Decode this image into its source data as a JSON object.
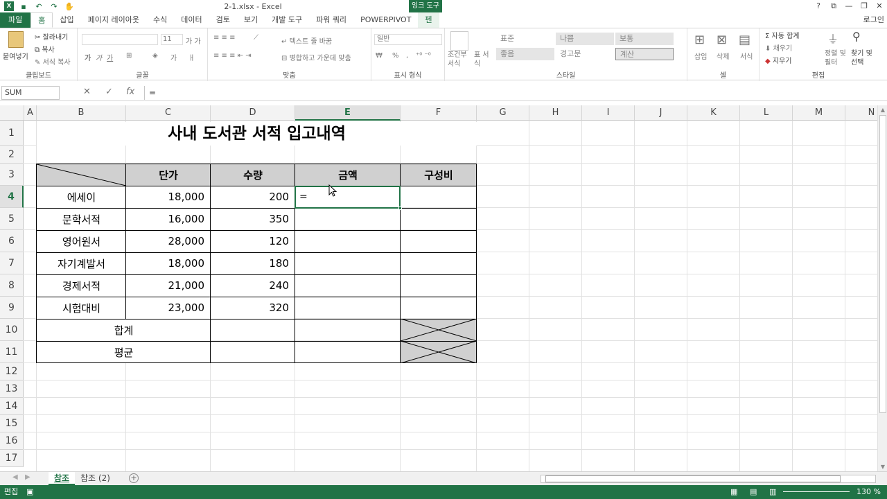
{
  "window": {
    "title": "2-1.xlsx - Excel",
    "context_tab_group": "잉크 도구",
    "controls": [
      "?",
      "⧉",
      "—",
      "❐",
      "✕"
    ],
    "login": "로그인"
  },
  "ribbon_tabs": [
    "파일",
    "홈",
    "삽입",
    "페이지 레이아웃",
    "수식",
    "데이터",
    "검토",
    "보기",
    "개발 도구",
    "파워 쿼리",
    "POWERPIVOT",
    "펜"
  ],
  "active_tab": "홈",
  "ribbon": {
    "clipboard": {
      "label": "클립보드",
      "paste": "붙여넣기",
      "cut": "잘라내기",
      "copy": "복사",
      "format_painter": "서식 복사"
    },
    "font": {
      "label": "글꼴",
      "size": "11",
      "bold": "가",
      "italic": "가",
      "underline": "가"
    },
    "alignment": {
      "label": "맞춤",
      "wrap": "텍스트 줄 바꿈",
      "merge": "병합하고 가운데 맞춤"
    },
    "number": {
      "label": "표시 형식",
      "format": "일반",
      "percent": "%",
      "comma": ","
    },
    "styles": {
      "label": "스타일",
      "conditional": "조건부 서식",
      "table": "표 서식",
      "cells": [
        "표준",
        "나쁨",
        "보통",
        "좋음",
        "경고문",
        "계산"
      ]
    },
    "cells": {
      "label": "셀",
      "insert": "삽입",
      "delete": "삭제",
      "format": "서식"
    },
    "editing": {
      "label": "편집",
      "autosum": "자동 합계",
      "fill": "채우기",
      "clear": "지우기",
      "sort_filter": "정렬 및 필터",
      "find_select": "찾기 및 선택"
    }
  },
  "formula_bar": {
    "name_box": "SUM",
    "cancel": "✕",
    "enter": "✓",
    "fx": "fx",
    "content": "="
  },
  "columns": [
    "A",
    "B",
    "C",
    "D",
    "E",
    "F",
    "G",
    "H",
    "I",
    "J",
    "K",
    "L",
    "M",
    "N"
  ],
  "selected_column": "E",
  "rows": [
    "1",
    "2",
    "3",
    "4",
    "5",
    "6",
    "7",
    "8",
    "9",
    "10",
    "11",
    "12",
    "13",
    "14",
    "15",
    "16",
    "17"
  ],
  "selected_row": "4",
  "sheet": {
    "title": "사내 도서관 서적 입고내역",
    "headers": {
      "price": "단가",
      "qty": "수량",
      "amount": "금액",
      "ratio": "구성비"
    },
    "items": [
      {
        "name": "에세이",
        "price": "18,000",
        "qty": "200"
      },
      {
        "name": "문학서적",
        "price": "16,000",
        "qty": "350"
      },
      {
        "name": "영어원서",
        "price": "28,000",
        "qty": "120"
      },
      {
        "name": "자기계발서",
        "price": "18,000",
        "qty": "180"
      },
      {
        "name": "경제서적",
        "price": "21,000",
        "qty": "240"
      },
      {
        "name": "시험대비",
        "price": "23,000",
        "qty": "320"
      }
    ],
    "total_label": "합계",
    "average_label": "평균",
    "editing_value": "="
  },
  "sheet_tabs": [
    "참조",
    "참조 (2)"
  ],
  "active_sheet": "참조",
  "status": {
    "mode": "편집",
    "zoom": "130 %"
  }
}
